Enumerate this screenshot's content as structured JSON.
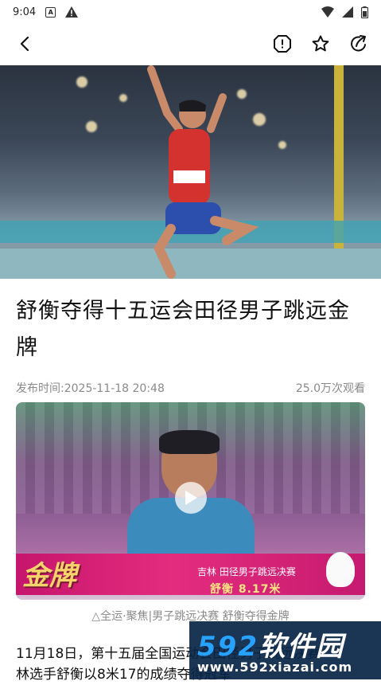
{
  "status_bar": {
    "time": "9:04",
    "a_icon_label": "A"
  },
  "app_bar": {
    "back_icon": "back-arrow-icon",
    "report_icon": "report-icon",
    "favorite_icon": "star-icon",
    "share_icon": "share-icon"
  },
  "article": {
    "title": "舒衡夺得十五运会田径男子跳远金牌",
    "publish_time": "发布时间:2025-11-18 20:48",
    "views": "25.0万次观看",
    "video": {
      "overlay_gold": "金牌",
      "overlay_event": "吉林 田径男子跳远决赛",
      "overlay_result": "舒衡 8.17米",
      "play_icon": "play-icon"
    },
    "video_caption": "△全运·聚焦|男子跳远决赛 舒衡夺得金牌",
    "body_line1": "11月18日，第十五届全国运动会田径男子跳远决赛",
    "body_line2": "林选手舒衡以8米17的成绩夺得冠军"
  },
  "watermark": {
    "brand_num": "592",
    "brand_text": "软件园",
    "url": "www.592xiazai.com"
  },
  "colors": {
    "accent_magenta": "#e42c7f",
    "gold_text": "#f7d36b",
    "watermark_bg": "#082445",
    "watermark_blue": "#27a3ff"
  }
}
